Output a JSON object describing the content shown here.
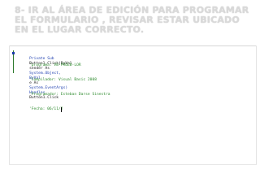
{
  "slide": {
    "title": "8- IR AL ÁREA DE EDICIÓN PARA PROGRAMAR EL FORMULARIO , REVISAR ESTAR UBICADO EN EL LUGAR CORRECTO."
  },
  "editor": {
    "sub_kw_1": "Private Sub",
    "sub_name": "Button1_Click(ByVal",
    "sub_sender": "sender As",
    "sub_system1": "System.Object,",
    "sub_byval2": "ByVal",
    "sub_e": "e As",
    "sub_eventargs": "System.EventArgs)",
    "sub_handles": "Handles",
    "sub_target": "Button1.Click",
    "comment_1": "'programa: VB-PRUEB-LOR",
    "comment_2": "'Compilador: Visual Basic 2008",
    "comment_3": "'Programador: Esteban Darse Sinestra",
    "comment_4": "'Fecha: 06/11/2"
  },
  "colors": {
    "keyword": "#1e3fb0",
    "comment": "#2e8b2e",
    "title": "#d9d9d9"
  }
}
